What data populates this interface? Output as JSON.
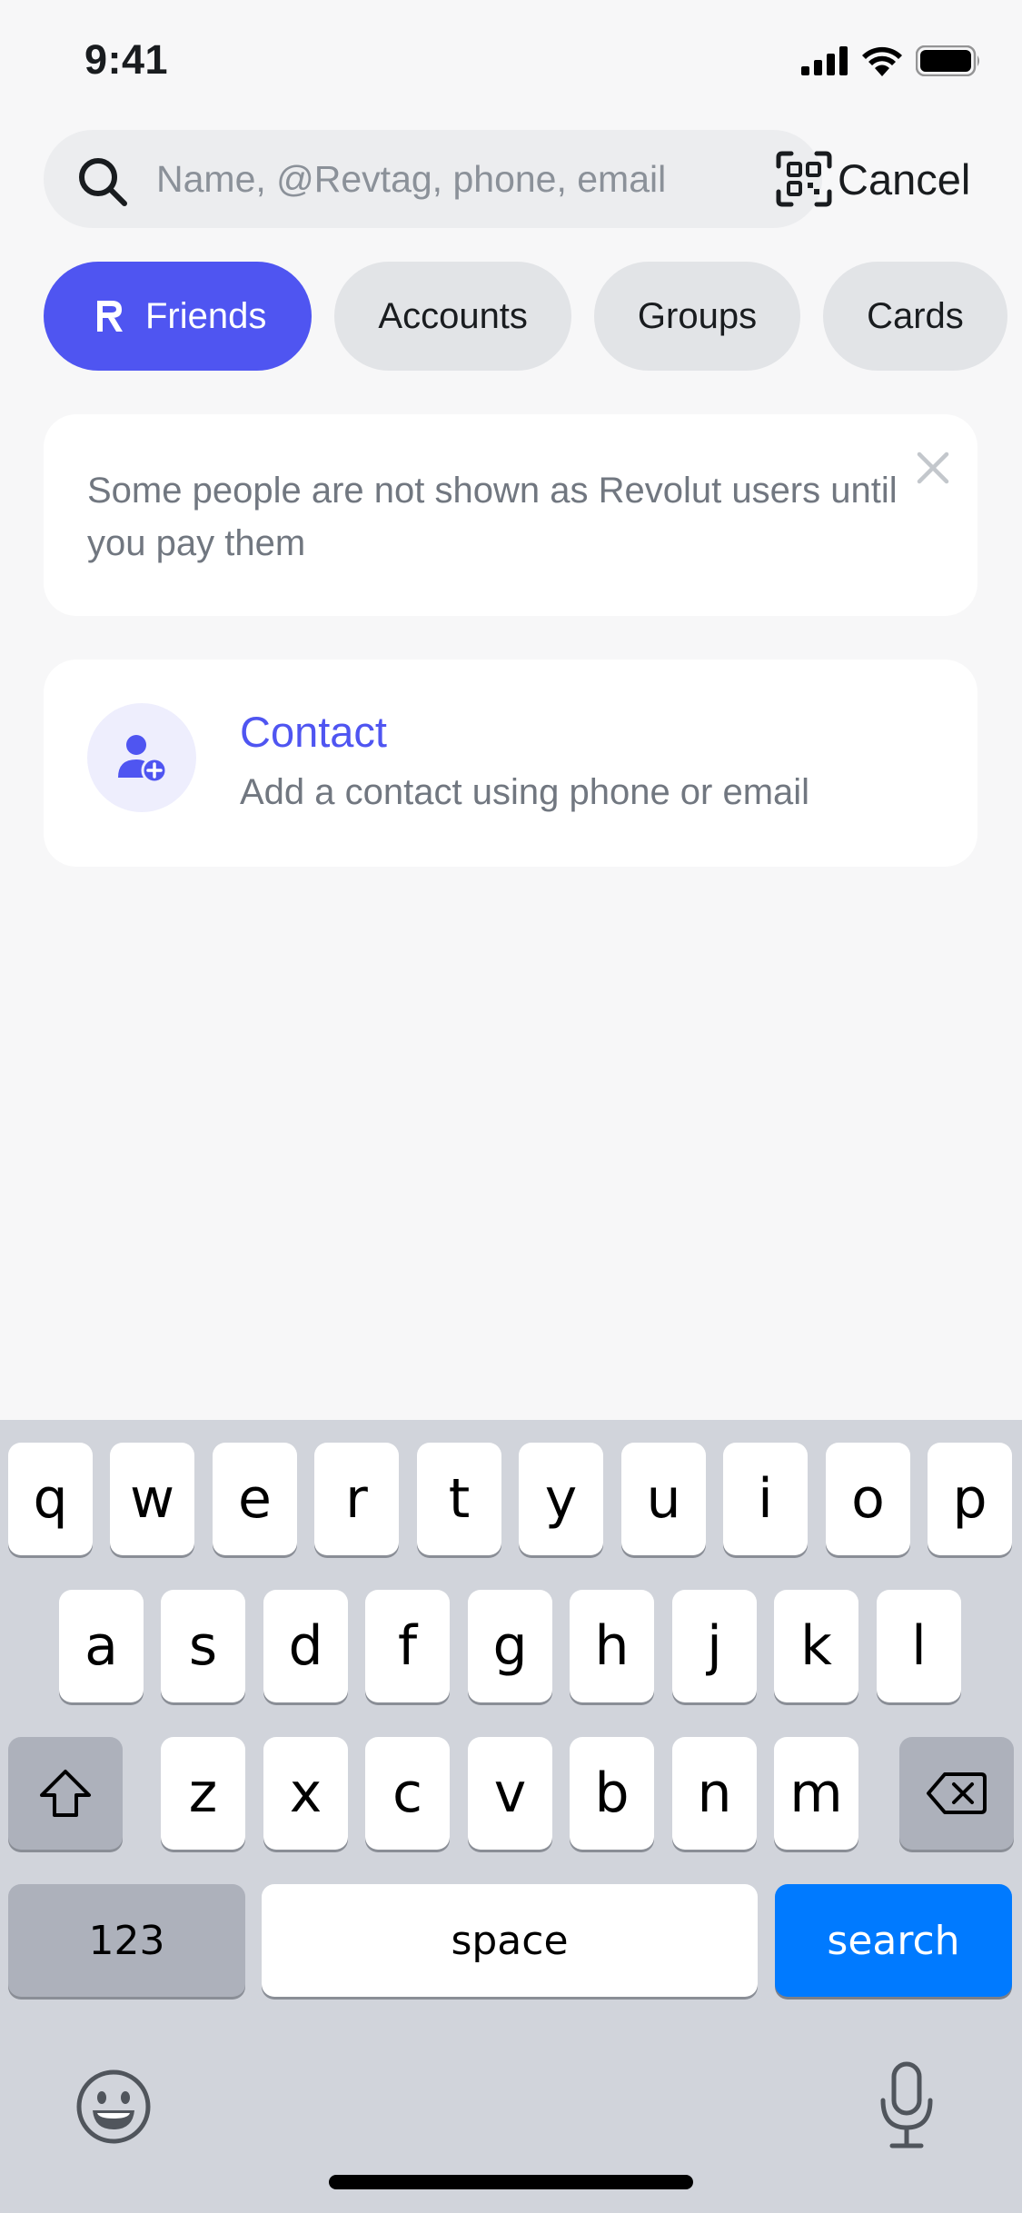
{
  "status_bar": {
    "time": "9:41"
  },
  "search": {
    "placeholder": "Name, @Revtag, phone, email",
    "value": "",
    "cancel_label": "Cancel"
  },
  "tabs": [
    {
      "label": "Friends",
      "active": true
    },
    {
      "label": "Accounts",
      "active": false
    },
    {
      "label": "Groups",
      "active": false
    },
    {
      "label": "Cards",
      "active": false
    }
  ],
  "info_banner": {
    "text": "Some people are not shown as Revolut users until you pay them"
  },
  "contact_item": {
    "title": "Contact",
    "subtitle": "Add a contact using phone or email"
  },
  "keyboard": {
    "row1": [
      "q",
      "w",
      "e",
      "r",
      "t",
      "y",
      "u",
      "i",
      "o",
      "p"
    ],
    "row2": [
      "a",
      "s",
      "d",
      "f",
      "g",
      "h",
      "j",
      "k",
      "l"
    ],
    "row3": [
      "z",
      "x",
      "c",
      "v",
      "b",
      "n",
      "m"
    ],
    "numbers_label": "123",
    "space_label": "space",
    "search_label": "search"
  },
  "colors": {
    "accent": "#4F55F1",
    "background": "#F7F7F8",
    "keyboard_bg": "#D1D4DB",
    "search_key": "#007AFF"
  },
  "icons": [
    "signal-icon",
    "wifi-icon",
    "battery-icon",
    "search-icon",
    "qr-code-icon",
    "revolut-r-icon",
    "close-icon",
    "add-contact-icon",
    "shift-icon",
    "backspace-icon",
    "emoji-icon",
    "microphone-icon"
  ]
}
